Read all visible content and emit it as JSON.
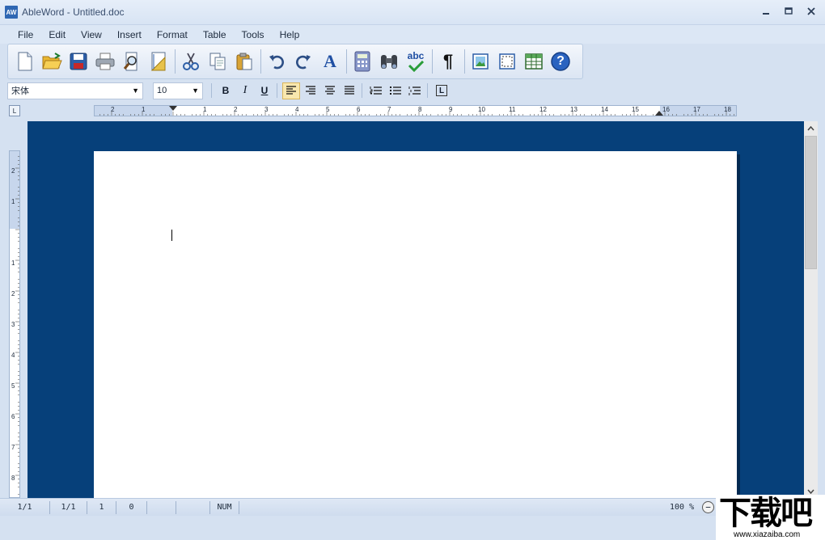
{
  "window": {
    "app_icon_text": "AW",
    "title": "AbleWord - Untitled.doc",
    "controls": {
      "minimize": "–",
      "maximize": "□",
      "close": "✕"
    }
  },
  "menu": [
    "File",
    "Edit",
    "View",
    "Insert",
    "Format",
    "Table",
    "Tools",
    "Help"
  ],
  "toolbar": {
    "buttons": [
      {
        "name": "new-document",
        "icon": "new-document-icon"
      },
      {
        "name": "open",
        "icon": "open-folder-icon"
      },
      {
        "name": "save",
        "icon": "save-disk-icon"
      },
      {
        "name": "print",
        "icon": "printer-icon"
      },
      {
        "name": "print-preview",
        "icon": "print-preview-icon"
      },
      {
        "name": "page-setup",
        "icon": "page-setup-icon"
      },
      {
        "name": "cut",
        "icon": "scissors-icon"
      },
      {
        "name": "copy",
        "icon": "copy-icon"
      },
      {
        "name": "paste",
        "icon": "paste-icon"
      },
      {
        "name": "undo",
        "icon": "undo-icon"
      },
      {
        "name": "redo",
        "icon": "redo-icon"
      },
      {
        "name": "font",
        "icon": "font-letter-icon"
      },
      {
        "name": "calculator",
        "icon": "calculator-icon"
      },
      {
        "name": "find",
        "icon": "binoculars-icon"
      },
      {
        "name": "spell-check",
        "icon": "spellcheck-icon"
      },
      {
        "name": "show-formatting",
        "icon": "pilcrow-icon"
      },
      {
        "name": "insert-picture",
        "icon": "picture-icon"
      },
      {
        "name": "insert-frame",
        "icon": "frame-icon"
      },
      {
        "name": "insert-table",
        "icon": "table-icon"
      },
      {
        "name": "help",
        "icon": "help-icon"
      }
    ],
    "spellcheck_text": "abc",
    "font_letter": "A",
    "pilcrow": "¶",
    "help_text": "?"
  },
  "format": {
    "font_name": "宋体",
    "font_size": "10",
    "bold": "B",
    "italic": "I",
    "underline": "U",
    "tab_stop": "L"
  },
  "ruler": {
    "corner": "L",
    "h_labels": [
      "2",
      "1",
      "1",
      "2",
      "3",
      "4",
      "5",
      "6",
      "7",
      "8",
      "9",
      "10",
      "11",
      "12",
      "13",
      "14",
      "15",
      "16",
      "17",
      "18"
    ],
    "v_labels": [
      "2",
      "1",
      "1",
      "2",
      "3",
      "4",
      "5",
      "6",
      "7",
      "8"
    ]
  },
  "status": {
    "page": "1/1",
    "section": "1/1",
    "line": "1",
    "column": "0",
    "num": "NUM",
    "zoom": "100 %",
    "zoom_out": "−"
  },
  "watermark": {
    "main": "下载吧",
    "sub": "www.xiazaiba.com"
  },
  "colors": {
    "doc_background": "#06407a",
    "chrome": "#d5e1f1"
  }
}
